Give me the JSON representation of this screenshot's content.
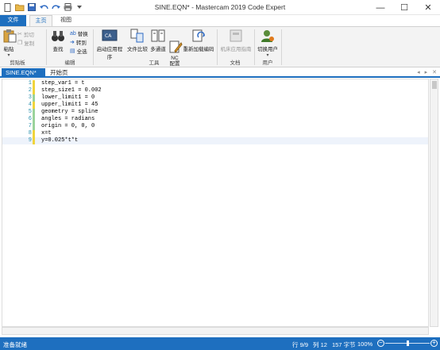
{
  "window": {
    "title": "SINE.EQN* - Mastercam 2019 Code Expert",
    "minimize": "—",
    "maximize": "☐",
    "close": "✕"
  },
  "ribbon_tabs": [
    "文件",
    "主页",
    "视图"
  ],
  "ribbon": {
    "clipboard": {
      "paste": "粘贴",
      "cut": "剪切",
      "copy": "复制",
      "group": "剪贴板"
    },
    "edit": {
      "find": "查找",
      "replace": "替换",
      "goto": "转到",
      "select_all": "全选",
      "group": "编辑"
    },
    "tools": {
      "launch_app": "启动应用程序",
      "file_compare": "文件比较",
      "multi_channel": "多通道",
      "nc_config": "NC\n配置",
      "reload_code": "重新加载编码",
      "group": "工具"
    },
    "file": {
      "machine_app_guide": "机床应用指南",
      "group": "文档"
    },
    "user": {
      "switch_user": "切换用户",
      "group": "用户"
    }
  },
  "doc_tabs": [
    "SINE.EQN*",
    "开始页"
  ],
  "editor": {
    "lines": [
      {
        "num": "1",
        "text": "step_var1 = t",
        "mark": "yellow"
      },
      {
        "num": "2",
        "text": "step_size1 = 0.002",
        "mark": "yellow"
      },
      {
        "num": "3",
        "text": "lower_limit1 = 0",
        "mark": "none"
      },
      {
        "num": "4",
        "text": "upper_limit1 = 45",
        "mark": "yellow"
      },
      {
        "num": "5",
        "text": "geometry = spline",
        "mark": "none"
      },
      {
        "num": "6",
        "text": "angles = radians",
        "mark": "none"
      },
      {
        "num": "7",
        "text": "origin = 0, 0, 0",
        "mark": "none"
      },
      {
        "num": "8",
        "text": "x=t",
        "mark": "yellow"
      },
      {
        "num": "9",
        "text": "y=0.025*t*t",
        "mark": "yellow"
      }
    ]
  },
  "status": {
    "ready": "准备就绪",
    "row": "行 9/9",
    "col": "列 12",
    "bytes": "157 字节",
    "zoom": "100%",
    "zoom_level": 0.5
  },
  "colors": {
    "accent": "#1e6fbf",
    "marker": "#f0d43c",
    "line_number": "#2b91af"
  }
}
